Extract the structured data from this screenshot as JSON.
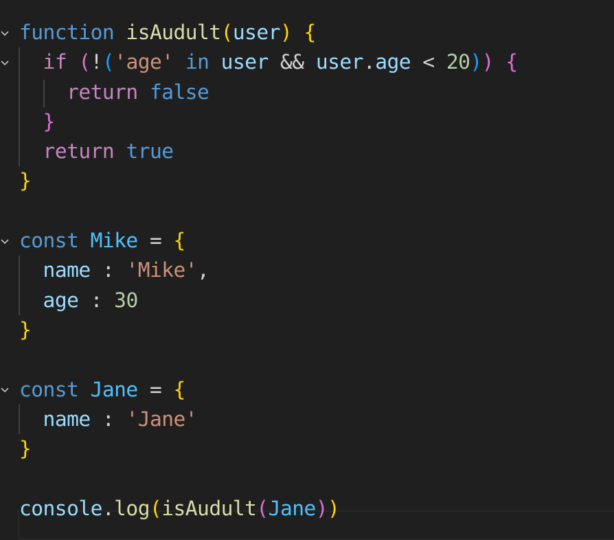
{
  "editor": {
    "language": "javascript",
    "theme_colors": {
      "background": "#1f1f1f",
      "keyword": "#569cd6",
      "control": "#c586c0",
      "function": "#dcdcaa",
      "variable": "#9cdcfe",
      "constant": "#4fc1ff",
      "string": "#ce9178",
      "number": "#b5cea8",
      "bracket_level_1": "#ffd700",
      "bracket_level_2": "#da70d6",
      "bracket_level_3": "#179fff"
    },
    "fold_icon": "chevron-down-icon",
    "lines": [
      {
        "fold": true,
        "indent": 0,
        "tokens": [
          {
            "t": "function",
            "c": "kw"
          },
          {
            "t": " ",
            "c": "op"
          },
          {
            "t": "isAudult",
            "c": "fn"
          },
          {
            "t": "(",
            "c": "b1"
          },
          {
            "t": "user",
            "c": "var"
          },
          {
            "t": ")",
            "c": "b1"
          },
          {
            "t": " ",
            "c": "op"
          },
          {
            "t": "{",
            "c": "b1"
          }
        ]
      },
      {
        "fold": true,
        "indent": 1,
        "tokens": [
          {
            "t": "if",
            "c": "ctl"
          },
          {
            "t": " ",
            "c": "op"
          },
          {
            "t": "(",
            "c": "b2"
          },
          {
            "t": "!",
            "c": "op"
          },
          {
            "t": "(",
            "c": "b3"
          },
          {
            "t": "'age'",
            "c": "str"
          },
          {
            "t": " ",
            "c": "op"
          },
          {
            "t": "in",
            "c": "kw"
          },
          {
            "t": " ",
            "c": "op"
          },
          {
            "t": "user",
            "c": "var"
          },
          {
            "t": " && ",
            "c": "op"
          },
          {
            "t": "user",
            "c": "var"
          },
          {
            "t": ".",
            "c": "op"
          },
          {
            "t": "age",
            "c": "var"
          },
          {
            "t": " < ",
            "c": "op"
          },
          {
            "t": "20",
            "c": "num"
          },
          {
            "t": ")",
            "c": "b3"
          },
          {
            "t": ")",
            "c": "b2"
          },
          {
            "t": " ",
            "c": "op"
          },
          {
            "t": "{",
            "c": "b2"
          }
        ]
      },
      {
        "fold": false,
        "indent": 2,
        "tokens": [
          {
            "t": "return",
            "c": "ctl"
          },
          {
            "t": " ",
            "c": "op"
          },
          {
            "t": "false",
            "c": "kw"
          }
        ]
      },
      {
        "fold": false,
        "indent": 1,
        "tokens": [
          {
            "t": "}",
            "c": "b2"
          }
        ]
      },
      {
        "fold": false,
        "indent": 1,
        "tokens": [
          {
            "t": "return",
            "c": "ctl"
          },
          {
            "t": " ",
            "c": "op"
          },
          {
            "t": "true",
            "c": "kw"
          }
        ]
      },
      {
        "fold": false,
        "indent": 0,
        "tokens": [
          {
            "t": "}",
            "c": "b1"
          }
        ]
      },
      {
        "fold": false,
        "indent": 0,
        "tokens": []
      },
      {
        "fold": true,
        "indent": 0,
        "tokens": [
          {
            "t": "const",
            "c": "kw"
          },
          {
            "t": " ",
            "c": "op"
          },
          {
            "t": "Mike",
            "c": "cst"
          },
          {
            "t": " = ",
            "c": "op"
          },
          {
            "t": "{",
            "c": "b1"
          }
        ]
      },
      {
        "fold": false,
        "indent": 1,
        "tokens": [
          {
            "t": "name",
            "c": "var"
          },
          {
            "t": " : ",
            "c": "op"
          },
          {
            "t": "'Mike'",
            "c": "str"
          },
          {
            "t": ",",
            "c": "op"
          }
        ]
      },
      {
        "fold": false,
        "indent": 1,
        "tokens": [
          {
            "t": "age",
            "c": "var"
          },
          {
            "t": " : ",
            "c": "op"
          },
          {
            "t": "30",
            "c": "num"
          }
        ]
      },
      {
        "fold": false,
        "indent": 0,
        "tokens": [
          {
            "t": "}",
            "c": "b1"
          }
        ]
      },
      {
        "fold": false,
        "indent": 0,
        "tokens": []
      },
      {
        "fold": true,
        "indent": 0,
        "tokens": [
          {
            "t": "const",
            "c": "kw"
          },
          {
            "t": " ",
            "c": "op"
          },
          {
            "t": "Jane",
            "c": "cst"
          },
          {
            "t": " = ",
            "c": "op"
          },
          {
            "t": "{",
            "c": "b1"
          }
        ]
      },
      {
        "fold": false,
        "indent": 1,
        "tokens": [
          {
            "t": "name",
            "c": "var"
          },
          {
            "t": " : ",
            "c": "op"
          },
          {
            "t": "'Jane'",
            "c": "str"
          }
        ]
      },
      {
        "fold": false,
        "indent": 0,
        "tokens": [
          {
            "t": "}",
            "c": "b1"
          }
        ]
      },
      {
        "fold": false,
        "indent": 0,
        "tokens": []
      },
      {
        "fold": false,
        "indent": 0,
        "current": true,
        "tokens": [
          {
            "t": "console",
            "c": "var"
          },
          {
            "t": ".",
            "c": "op"
          },
          {
            "t": "log",
            "c": "fn"
          },
          {
            "t": "(",
            "c": "b1"
          },
          {
            "t": "isAudult",
            "c": "fn"
          },
          {
            "t": "(",
            "c": "b2"
          },
          {
            "t": "Jane",
            "c": "cst"
          },
          {
            "t": ")",
            "c": "b2"
          },
          {
            "t": ")",
            "c": "b1"
          }
        ]
      }
    ]
  }
}
